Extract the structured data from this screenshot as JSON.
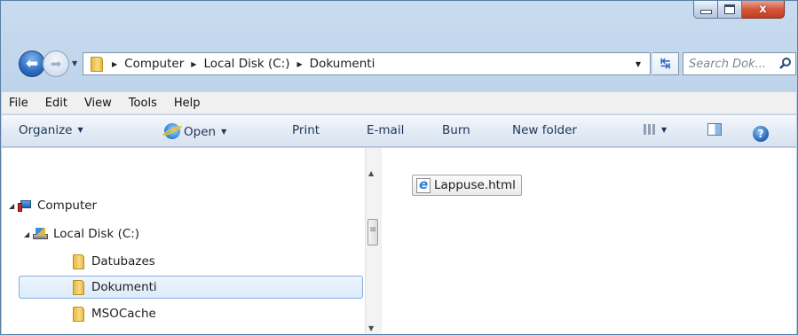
{
  "caption_buttons": {
    "minimize": "minimize",
    "maximize": "maximize",
    "close": "x"
  },
  "address_bar": {
    "breadcrumbs": [
      "Computer",
      "Local Disk (C:)",
      "Dokumenti"
    ],
    "separator": "▸"
  },
  "search": {
    "placeholder": "Search Dok..."
  },
  "menu": [
    "File",
    "Edit",
    "View",
    "Tools",
    "Help"
  ],
  "toolbar": {
    "organize": "Organize",
    "open": "Open",
    "print": "Print",
    "email": "E-mail",
    "burn": "Burn",
    "new_folder": "New folder"
  },
  "tree": {
    "computer": "Computer",
    "local_disk": "Local Disk (C:)",
    "folders": [
      "Datubazes",
      "Dokumenti",
      "MSOCache"
    ],
    "selected": "Dokumenti"
  },
  "files": [
    {
      "name": "Lappuse.html",
      "icon": "ie-html-icon"
    }
  ],
  "colors": {
    "selection_border": "#84acdd",
    "frame": "#bcd3ea"
  }
}
